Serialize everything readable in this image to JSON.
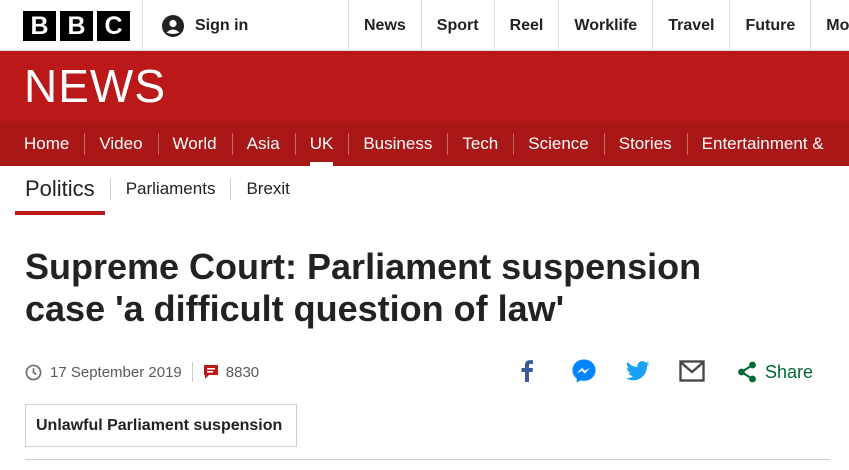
{
  "brand": {
    "logo_letters": [
      "B",
      "B",
      "C"
    ],
    "news_wordmark": "NEWS",
    "colors": {
      "news_red": "#bb1919",
      "nav_red": "#a91717",
      "share_green": "#006633"
    }
  },
  "account": {
    "signin_label": "Sign in"
  },
  "top_nav": [
    "News",
    "Sport",
    "Reel",
    "Worklife",
    "Travel",
    "Future",
    "Mo"
  ],
  "section_nav": {
    "items": [
      "Home",
      "Video",
      "World",
      "Asia",
      "UK",
      "Business",
      "Tech",
      "Science",
      "Stories",
      "Entertainment &"
    ],
    "active": "UK"
  },
  "sub_nav": {
    "primary": "Politics",
    "items": [
      "Parliaments",
      "Brexit"
    ]
  },
  "article": {
    "headline_line1": "Supreme Court: Parliament suspension",
    "headline_line2": "case 'a difficult question of law'",
    "date": "17 September 2019",
    "comment_count": "8830",
    "tag": "Unlawful Parliament suspension"
  },
  "share": {
    "icons": [
      "facebook-icon",
      "messenger-icon",
      "twitter-icon",
      "email-icon"
    ],
    "label": "Share"
  }
}
